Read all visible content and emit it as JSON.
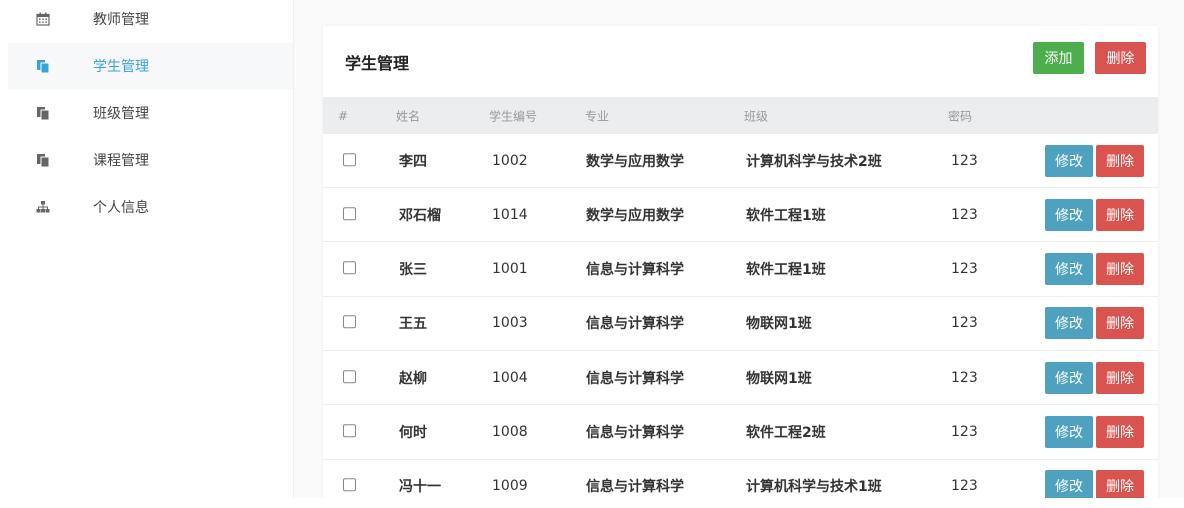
{
  "sidebar": {
    "items": [
      {
        "label": "教师管理",
        "icon": "calendar-icon",
        "active": false
      },
      {
        "label": "学生管理",
        "icon": "copy-icon",
        "active": true
      },
      {
        "label": "班级管理",
        "icon": "copy-icon",
        "active": false
      },
      {
        "label": "课程管理",
        "icon": "copy-icon",
        "active": false
      },
      {
        "label": "个人信息",
        "icon": "sitemap-icon",
        "active": false
      }
    ]
  },
  "panel": {
    "title": "学生管理",
    "add_label": "添加",
    "delete_label": "删除"
  },
  "table": {
    "headers": [
      "#",
      "姓名",
      "学生编号",
      "专业",
      "班级",
      "密码"
    ],
    "rows": [
      {
        "name": "李四",
        "id": "1002",
        "major": "数学与应用数学",
        "class": "计算机科学与技术2班",
        "password": "123"
      },
      {
        "name": "邓石榴",
        "id": "1014",
        "major": "数学与应用数学",
        "class": "软件工程1班",
        "password": "123"
      },
      {
        "name": "张三",
        "id": "1001",
        "major": "信息与计算科学",
        "class": "软件工程1班",
        "password": "123"
      },
      {
        "name": "王五",
        "id": "1003",
        "major": "信息与计算科学",
        "class": "物联网1班",
        "password": "123"
      },
      {
        "name": "赵柳",
        "id": "1004",
        "major": "信息与计算科学",
        "class": "物联网1班",
        "password": "123"
      },
      {
        "name": "何时",
        "id": "1008",
        "major": "信息与计算科学",
        "class": "软件工程2班",
        "password": "123"
      },
      {
        "name": "冯十一",
        "id": "1009",
        "major": "信息与计算科学",
        "class": "计算机科学与技术1班",
        "password": "123"
      }
    ],
    "edit_label": "修改",
    "delete_label": "删除"
  },
  "colors": {
    "active": "#3aa3d6",
    "add": "#4cae4c",
    "danger": "#d9534f",
    "info": "#4fa2bf"
  }
}
